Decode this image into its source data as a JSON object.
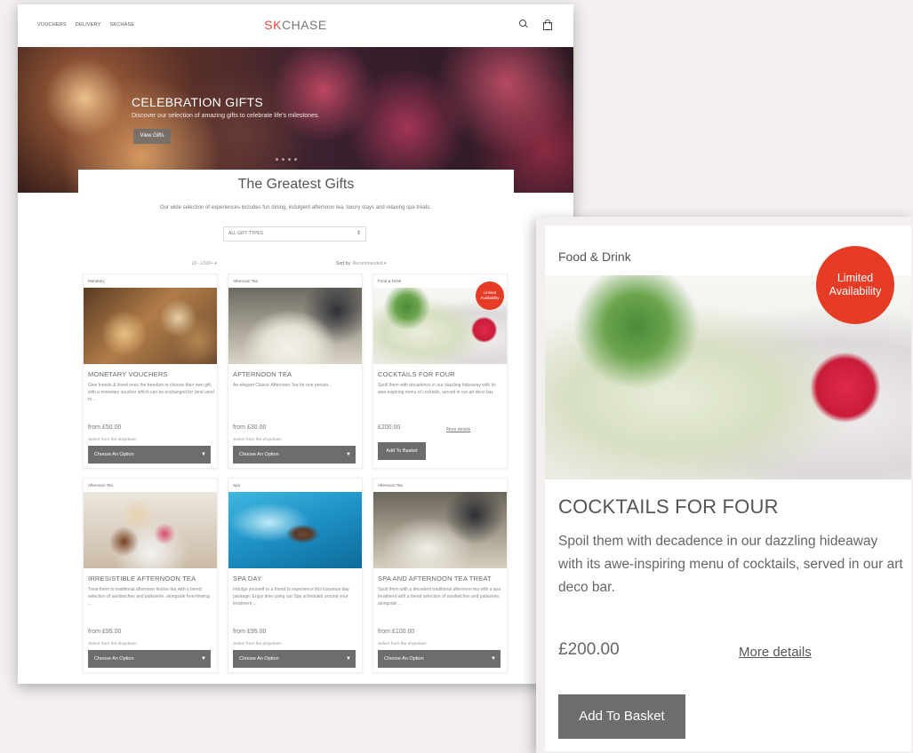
{
  "nav": {
    "links": [
      "VOUCHERS",
      "DELIVERY",
      "SKCHASE"
    ],
    "logo_accent": "SK",
    "logo_rest": "CHASE"
  },
  "hero": {
    "title": "CELEBRATION GIFTS",
    "subtitle": "Discover our selection of amazing gifts to celebrate life's milestones.",
    "button": "View Gifts"
  },
  "main": {
    "heading": "The Greatest Gifts",
    "intro": "Our wide selection of experiences includes fun dining, indulgent afternoon tea, luxury stays and relaxing spa treats.",
    "gift_type_select": "ALL GIFT TYPES",
    "price_filter": "£0 - £300+ ▾",
    "sort_label": "Sort by:",
    "sort_value": "Recommended ▾"
  },
  "products": [
    {
      "category": "Monetary",
      "title": "MONETARY VOUCHERS",
      "desc": "Give friends & loved ones the freedom to choose their own gift, with a monetary voucher which can be exchanged for (and used to ...",
      "price": "from £50.00",
      "hint": "Select from the dropdown",
      "action": "Choose An Option"
    },
    {
      "category": "Afternoon Tea",
      "title": "AFTERNOON TEA",
      "desc": "An elegant Classic Afternoon Tea for one person.",
      "price": "from £30.00",
      "hint": "Select from the dropdown",
      "action": "Choose An Option"
    },
    {
      "category": "Food & Drink",
      "title": "COCKTAILS FOR FOUR",
      "desc": "Spoil them with decadence in our dazzling hideaway with its awe-inspiring menu of cocktails, served in our art deco bar.",
      "price": "£200.00",
      "more": "More details",
      "action": "Add To Basket",
      "badge": "Limited Availability"
    },
    {
      "category": "Afternoon Tea",
      "title": "IRRESISTIBLE AFTERNOON TEA",
      "desc": "Treat them to traditional afternoon festive tea with a tiered selection of sandwiches and patisserie, alongside free-flowing ...",
      "price": "from £95.00",
      "hint": "Select from the dropdown",
      "action": "Choose An Option"
    },
    {
      "category": "Spa",
      "title": "SPA DAY",
      "desc": "Indulge yourself or a friend to experience this luxurious day package. Enjoy time using our Spa scheduled around your treatment ...",
      "price": "from £95.00",
      "hint": "Select from the dropdown",
      "action": "Choose An Option"
    },
    {
      "category": "Afternoon Tea",
      "title": "SPA AND AFTERNOON TEA TREAT",
      "desc": "Spoil them with a decadent traditional afternoon tea with a spa treatment with a tiered selection of sandwiches and patisserie, alongside ...",
      "price": "from £100.00",
      "hint": "Select from the dropdown",
      "action": "Choose An Option"
    }
  ],
  "zoom": {
    "category": "Food & Drink",
    "badge_line1": "Limited",
    "badge_line2": "Availability",
    "title": "COCKTAILS FOR FOUR",
    "desc": "Spoil them with decadence in our dazzling hideaway with its awe-inspiring menu of cocktails, served in our art deco bar.",
    "price": "£200.00",
    "more": "More details",
    "button": "Add To Basket"
  },
  "colors": {
    "accent": "#e63c25",
    "button_grey": "#6d6d6d",
    "background": "#f2efee"
  }
}
